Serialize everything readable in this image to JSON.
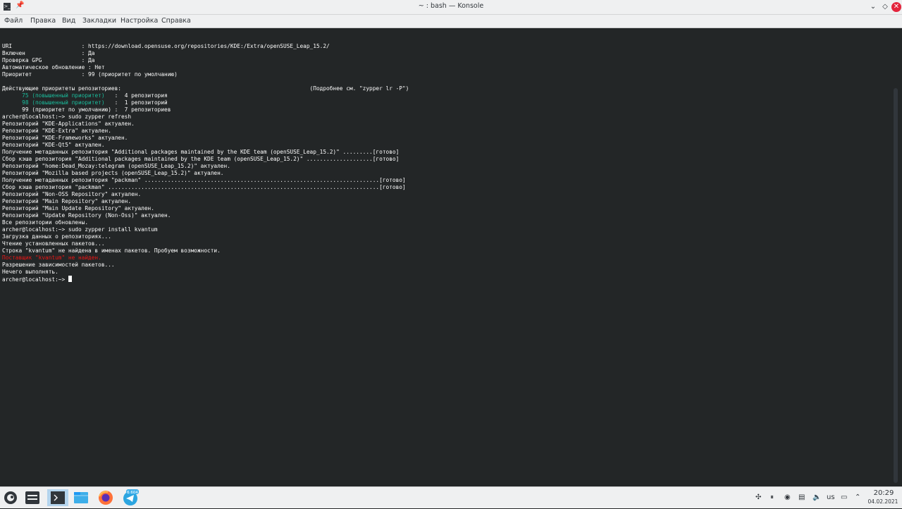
{
  "window": {
    "title": "~ : bash — Konsole"
  },
  "menu": [
    "Файл",
    "Правка",
    "Вид",
    "Закладки",
    "Настройка",
    "Справка"
  ],
  "terminal": {
    "lines": [
      [
        {
          "t": ""
        }
      ],
      [
        {
          "t": "URI                     : https://download.opensuse.org/repositories/KDE:/Extra/openSUSE_Leap_15.2/"
        }
      ],
      [
        {
          "t": "Включен                 : Да"
        }
      ],
      [
        {
          "t": "Проверка GPG            : Да"
        }
      ],
      [
        {
          "t": "Автоматическое обновление : Нет"
        }
      ],
      [
        {
          "t": "Приоритет               : 99 (приоритет по умолчанию)"
        }
      ],
      [
        {
          "t": ""
        }
      ],
      [
        {
          "t": "Действующие приоритеты репозиториев:                                                         (Подробнее см. \"zypper lr -P\")"
        }
      ],
      [
        {
          "t": "      "
        },
        {
          "t": "75 (повышенный приоритет)",
          "c": "teal"
        },
        {
          "t": "   :  4 репозитория"
        }
      ],
      [
        {
          "t": "      "
        },
        {
          "t": "98 (повышенный приоритет)",
          "c": "teal"
        },
        {
          "t": "   :  1 репозиторий"
        }
      ],
      [
        {
          "t": "      99 (приоритет по умолчанию) :  7 репозиториев"
        }
      ],
      [
        {
          "t": "archer@localhost:~> sudo zypper refresh"
        }
      ],
      [
        {
          "t": "Репозиторий \"KDE-Applications\" актуален."
        }
      ],
      [
        {
          "t": "Репозиторий \"KDE-Extra\" актуален."
        }
      ],
      [
        {
          "t": "Репозиторий \"KDE-Frameworks\" актуален."
        }
      ],
      [
        {
          "t": "Репозиторий \"KDE-Qt5\" актуален."
        }
      ],
      [
        {
          "t": "Получение метаданных репозитория \"Additional packages maintained by the KDE team (openSUSE_Leap_15.2)\" .........[готово]"
        }
      ],
      [
        {
          "t": "Сбор кэша репозитория \"Additional packages maintained by the KDE team (openSUSE_Leap_15.2)\" ....................[готово]"
        }
      ],
      [
        {
          "t": "Репозиторий \"home:Dead_Mozay:telegram (openSUSE_Leap_15.2)\" актуален."
        }
      ],
      [
        {
          "t": "Репозиторий \"Mozilla based projects (openSUSE_Leap_15.2)\" актуален."
        }
      ],
      [
        {
          "t": "Получение метаданных репозитория \"packman\" .......................................................................[готово]"
        }
      ],
      [
        {
          "t": "Сбор кэша репозитория \"packman\" ..................................................................................[готово]"
        }
      ],
      [
        {
          "t": "Репозиторий \"Non-OSS Repository\" актуален."
        }
      ],
      [
        {
          "t": "Репозиторий \"Main Repository\" актуален."
        }
      ],
      [
        {
          "t": "Репозиторий \"Main Update Repository\" актуален."
        }
      ],
      [
        {
          "t": "Репозиторий \"Update Repository (Non-Oss)\" актуален."
        }
      ],
      [
        {
          "t": "Все репозитории обновлены."
        }
      ],
      [
        {
          "t": "archer@localhost:~> sudo zypper install kvantum"
        }
      ],
      [
        {
          "t": "Загрузка данных о репозиториях..."
        }
      ],
      [
        {
          "t": "Чтение установленных пакетов..."
        }
      ],
      [
        {
          "t": "Строка \"kvantum\" не найдена в именах пакетов. Пробуем возможности."
        }
      ],
      [
        {
          "t": "Поставщик \"kvantum\" не найден.",
          "c": "red"
        }
      ],
      [
        {
          "t": "Разрешение зависимостей пакетов..."
        }
      ],
      [
        {
          "t": "Нечего выполнять."
        }
      ],
      [
        {
          "t": "archer@localhost:~> "
        }
      ]
    ]
  },
  "taskbar": {
    "badge": "6 604",
    "tray_keyboard": "us",
    "clock_time": "20:29",
    "clock_date": "04.02.2021",
    "icons": [
      "application-launcher-icon",
      "task-manager-icon",
      "konsole-icon",
      "dolphin-icon",
      "firefox-icon",
      "telegram-icon"
    ]
  }
}
